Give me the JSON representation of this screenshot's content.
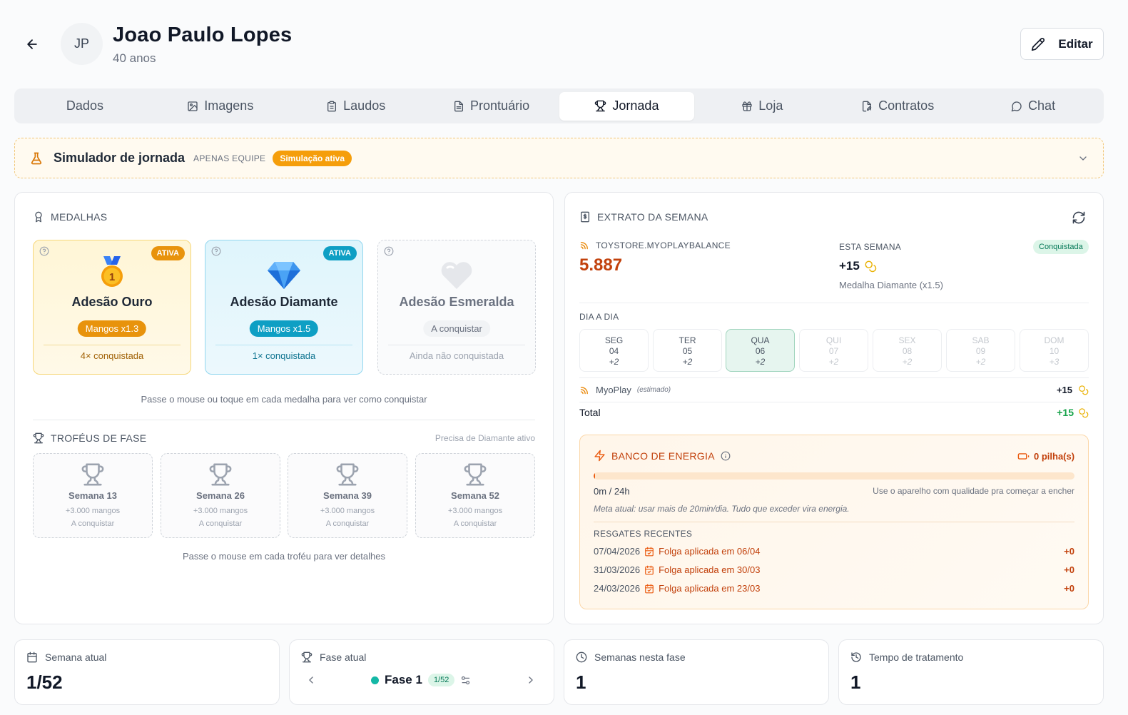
{
  "patient": {
    "initials": "JP",
    "name": "Joao Paulo Lopes",
    "age": "40 anos"
  },
  "header": {
    "edit_label": "Editar"
  },
  "tabs": [
    {
      "label": "Dados",
      "icon": ""
    },
    {
      "label": "Imagens",
      "icon": "image-icon"
    },
    {
      "label": "Laudos",
      "icon": "clipboard-icon"
    },
    {
      "label": "Prontuário",
      "icon": "file-text-icon"
    },
    {
      "label": "Jornada",
      "icon": "trophy-icon"
    },
    {
      "label": "Loja",
      "icon": "gift-icon"
    },
    {
      "label": "Contratos",
      "icon": "file-signature-icon"
    },
    {
      "label": "Chat",
      "icon": "message-circle-icon"
    }
  ],
  "active_tab": "Jornada",
  "simulator": {
    "title": "Simulador de jornada",
    "team_only": "APENAS EQUIPE",
    "status": "Simulação ativa"
  },
  "medals": {
    "title": "MEDALHAS",
    "items": [
      {
        "name": "Adesão Ouro",
        "badge": "ATIVA",
        "multiplier": "Mangos x1.3",
        "status": "4× conquistada",
        "icon": "gold-medal-icon",
        "medal_number": "1"
      },
      {
        "name": "Adesão Diamante",
        "badge": "ATIVA",
        "multiplier": "Mangos x1.5",
        "status": "1× conquistada",
        "icon": "diamond-icon"
      },
      {
        "name": "Adesão Esmeralda",
        "badge": "",
        "multiplier": "A conquistar",
        "status": "Ainda não conquistada",
        "icon": "heart-icon"
      }
    ],
    "hint": "Passe o mouse ou toque em cada medalha para ver como conquistar"
  },
  "trophies": {
    "title": "TROFÉUS DE FASE",
    "requirement": "Precisa de Diamante ativo",
    "items": [
      {
        "week": "Semana 13",
        "reward": "+3.000 mangos",
        "status": "A conquistar"
      },
      {
        "week": "Semana 26",
        "reward": "+3.000 mangos",
        "status": "A conquistar"
      },
      {
        "week": "Semana 39",
        "reward": "+3.000 mangos",
        "status": "A conquistar"
      },
      {
        "week": "Semana 52",
        "reward": "+3.000 mangos",
        "status": "A conquistar"
      }
    ],
    "hint": "Passe o mouse em cada troféu para ver detalhes"
  },
  "statement": {
    "title": "EXTRATO DA SEMANA",
    "balance_label": "TOYSTORE.MYOPLAYBALANCE",
    "balance_value": "5.887",
    "week_label": "ESTA SEMANA",
    "week_value": "+15",
    "week_badge": "Conquistada",
    "week_note": "Medalha Diamante (x1.5)",
    "daily_label": "DIA A DIA",
    "days": [
      {
        "name": "SEG",
        "date": "04",
        "value": "+2",
        "state": "past"
      },
      {
        "name": "TER",
        "date": "05",
        "value": "+2",
        "state": "past"
      },
      {
        "name": "QUA",
        "date": "06",
        "value": "+2",
        "state": "today"
      },
      {
        "name": "QUI",
        "date": "07",
        "value": "+2",
        "state": "future"
      },
      {
        "name": "SEX",
        "date": "08",
        "value": "+2",
        "state": "future"
      },
      {
        "name": "SAB",
        "date": "09",
        "value": "+2",
        "state": "future"
      },
      {
        "name": "DOM",
        "date": "10",
        "value": "+3",
        "state": "future"
      }
    ],
    "myoplay_label": "MyoPlay",
    "myoplay_note": "(estimado)",
    "myoplay_value": "+15",
    "total_label": "Total",
    "total_value": "+15"
  },
  "energy": {
    "title": "BANCO DE ENERGIA",
    "batteries": "0 pilha(s)",
    "progress_fraction": 0.0,
    "usage": "0m / 24h",
    "usage_hint": "Use o aparelho com qualidade pra começar a encher",
    "goal": "Meta atual: usar mais de 20min/dia. Tudo que exceder vira energia.",
    "rescues_title": "RESGATES RECENTES",
    "rescues": [
      {
        "date": "07/04/2026",
        "desc": "Folga aplicada em 06/04",
        "value": "+0"
      },
      {
        "date": "31/03/2026",
        "desc": "Folga aplicada em 30/03",
        "value": "+0"
      },
      {
        "date": "24/03/2026",
        "desc": "Folga aplicada em 23/03",
        "value": "+0"
      }
    ]
  },
  "stats": [
    {
      "label": "Semana atual",
      "value": "1/52",
      "icon": "calendar-icon"
    },
    {
      "label": "Fase atual",
      "phase": "Fase 1",
      "phase_badge": "1/52",
      "icon": "trophy-icon"
    },
    {
      "label": "Semanas nesta fase",
      "value": "1",
      "icon": "clock-icon"
    },
    {
      "label": "Tempo de tratamento",
      "value": "1",
      "icon": "history-icon"
    }
  ],
  "colors": {
    "accent_orange": "#c2410c",
    "amber": "#f59e0b",
    "teal": "#0ea5c6",
    "green": "#16a34a",
    "phase_dot": "#14b8a6"
  }
}
